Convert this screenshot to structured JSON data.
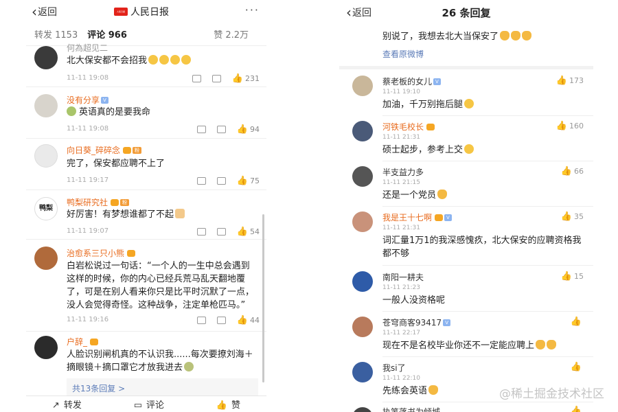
{
  "left": {
    "back_label": "返回",
    "brand": "人民日报",
    "logo_text": "人民日报",
    "more": "···",
    "tabs": {
      "repost": "转发 1153",
      "comments": "评论 966",
      "likes": "赞 2.2万"
    },
    "top_partial_name": "何為超见二",
    "comments": [
      {
        "name": "",
        "text": "北大保安都不会招我",
        "time": "11-11 19:08",
        "likes": "231"
      },
      {
        "name": "没有分享",
        "text": "英语真的是要我命",
        "time": "11-11 19:08",
        "likes": "94"
      },
      {
        "name": "向日葵_碎碎念",
        "text": "完了，保安都应聘不上了",
        "time": "11-11 19:17",
        "likes": "75"
      },
      {
        "name": "鸭梨研究社",
        "text": "好厉害！有梦想谁都了不起",
        "time": "11-11 19:07",
        "likes": "54"
      },
      {
        "name": "治愈系三只小熊",
        "text": "白岩松说过一句话：“一个人的一生中总会遇到这样的时候，你的内心已经兵荒马乱天翻地覆了，可是在别人看来你只是比平时沉默了一点，没人会觉得奇怪。这种战争，注定单枪匹马。”",
        "time": "11-11 19:16",
        "likes": "44"
      },
      {
        "name": "户辞_",
        "text": "人脸识别闸机真的不认识我......每次要撩刘海＋摘眼镜＋摘口罩它才放我进去",
        "time": "",
        "likes": ""
      }
    ],
    "avatar_text_4": "鸭梨",
    "reply_more": "共13条回复 >",
    "bottom": {
      "repost": "转发",
      "comment": "评论",
      "like": "赞"
    }
  },
  "right": {
    "back_label": "返回",
    "title": "26 条回复",
    "orig_text": "别说了，我想去北大当保安了",
    "orig_link": "查看原微博",
    "replies": [
      {
        "name": "蔡老板的女儿",
        "text": "加油，千万别拖后腿",
        "time": "11-11 19:10",
        "likes": "173"
      },
      {
        "name": "河铁毛校长",
        "text": "硕士起步，参考上交",
        "time": "11-11 21:31",
        "likes": "160"
      },
      {
        "name": "半支益力多",
        "text": "还是一个党员",
        "time": "11-11 21:15",
        "likes": "66"
      },
      {
        "name": "我是王十七啊",
        "text": "词汇量1万1的我深感愧疚，北大保安的应聘资格我都不够",
        "time": "11-11 21:31",
        "likes": "35"
      },
      {
        "name": "南阳一耕夫",
        "text": "一般人没资格呢",
        "time": "11-11 21:23",
        "likes": "15"
      },
      {
        "name": "苍穹商客93417",
        "text": "现在不是名校毕业你还不一定能应聘上",
        "time": "11-11 22:17",
        "likes": ""
      },
      {
        "name": "我si了",
        "text": "先练会英语",
        "time": "11-11 22:10",
        "likes": ""
      },
      {
        "name": "执笔落书为倾城",
        "text": "",
        "time": "",
        "likes": ""
      }
    ]
  },
  "watermark": "@稀土掘金技术社区",
  "colors": {
    "name_orange": "#e86b1e",
    "link_blue": "#5c7cb8",
    "badge_orange": "#f29c38"
  }
}
